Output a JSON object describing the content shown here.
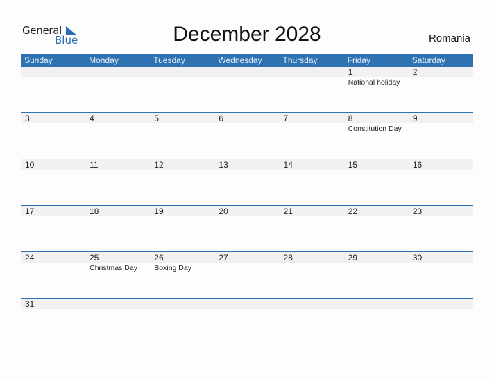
{
  "logo": {
    "text_general": "General",
    "text_blue": "Blue",
    "icon": "triangle-flag-icon"
  },
  "title": "December 2028",
  "country": "Romania",
  "day_names": [
    "Sunday",
    "Monday",
    "Tuesday",
    "Wednesday",
    "Thursday",
    "Friday",
    "Saturday"
  ],
  "weeks": [
    [
      {
        "day": ""
      },
      {
        "day": ""
      },
      {
        "day": ""
      },
      {
        "day": ""
      },
      {
        "day": ""
      },
      {
        "day": "1",
        "holiday": "National holiday"
      },
      {
        "day": "2"
      }
    ],
    [
      {
        "day": "3"
      },
      {
        "day": "4"
      },
      {
        "day": "5"
      },
      {
        "day": "6"
      },
      {
        "day": "7"
      },
      {
        "day": "8",
        "holiday": "Constitution Day"
      },
      {
        "day": "9"
      }
    ],
    [
      {
        "day": "10"
      },
      {
        "day": "11"
      },
      {
        "day": "12"
      },
      {
        "day": "13"
      },
      {
        "day": "14"
      },
      {
        "day": "15"
      },
      {
        "day": "16"
      }
    ],
    [
      {
        "day": "17"
      },
      {
        "day": "18"
      },
      {
        "day": "19"
      },
      {
        "day": "20"
      },
      {
        "day": "21"
      },
      {
        "day": "22"
      },
      {
        "day": "23"
      }
    ],
    [
      {
        "day": "24"
      },
      {
        "day": "25",
        "holiday": "Christmas Day"
      },
      {
        "day": "26",
        "holiday": "Boxing Day"
      },
      {
        "day": "27"
      },
      {
        "day": "28"
      },
      {
        "day": "29"
      },
      {
        "day": "30"
      }
    ],
    [
      {
        "day": "31"
      },
      {
        "day": ""
      },
      {
        "day": ""
      },
      {
        "day": ""
      },
      {
        "day": ""
      },
      {
        "day": ""
      },
      {
        "day": ""
      }
    ]
  ],
  "colors": {
    "accent": "#2e72b2",
    "strip": "#f1f1f1"
  }
}
